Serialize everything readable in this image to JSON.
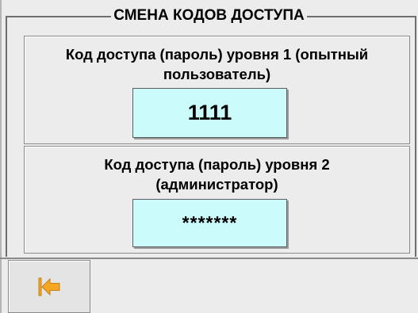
{
  "group": {
    "title": "СМЕНА КОДОВ ДОСТУПА"
  },
  "level1": {
    "label_line1": "Код доступа (пароль) уровня 1 (опытный",
    "label_line2": "пользователь)",
    "value": "1111"
  },
  "level2": {
    "label_line1": "Код доступа (пароль) уровня 2",
    "label_line2": "(администратор)",
    "value": "*******"
  },
  "footer": {
    "back_icon": "back-arrow-icon"
  },
  "colors": {
    "field_bg": "#ccfbfc",
    "icon_orange": "#f5a623",
    "panel_bg": "#ececec"
  }
}
